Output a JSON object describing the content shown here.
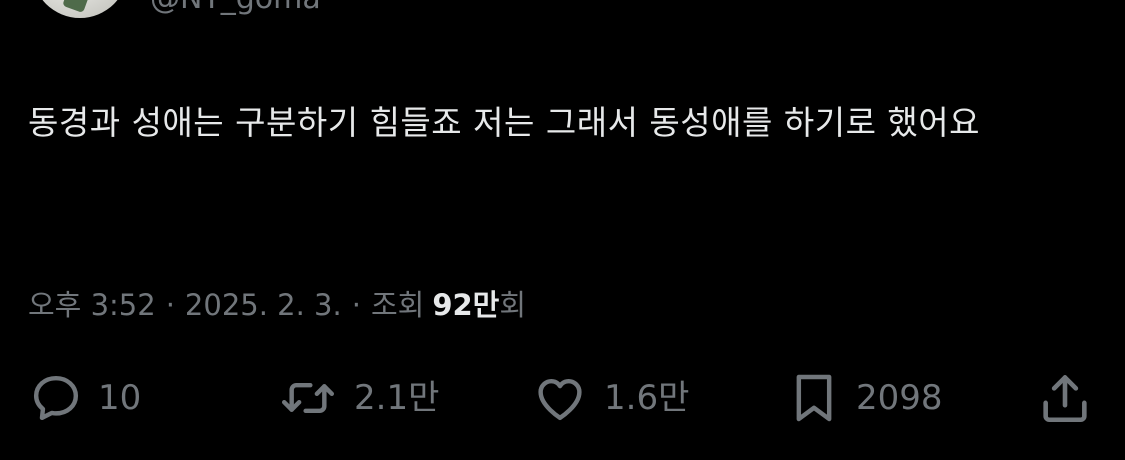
{
  "author": {
    "handle": "@NY_goma"
  },
  "tweet": {
    "text": "동경과 성애는 구분하기 힘들죠 저는 그래서 동성애를 하기로 했어요"
  },
  "meta": {
    "time": "오후 3:52",
    "date": "2025. 2. 3.",
    "separator": "·",
    "views_prefix": "조회",
    "views_number": "92만",
    "views_suffix": "회"
  },
  "actions": {
    "reply_count": "10",
    "retweet_count": "2.1만",
    "like_count": "1.6만",
    "bookmark_count": "2098"
  },
  "icons": {
    "reply": "reply-icon",
    "retweet": "retweet-icon",
    "like": "heart-icon",
    "bookmark": "bookmark-icon",
    "share": "share-icon"
  },
  "colors": {
    "background": "#000000",
    "primary_text": "#e7e9ea",
    "secondary_text": "#71767b"
  }
}
